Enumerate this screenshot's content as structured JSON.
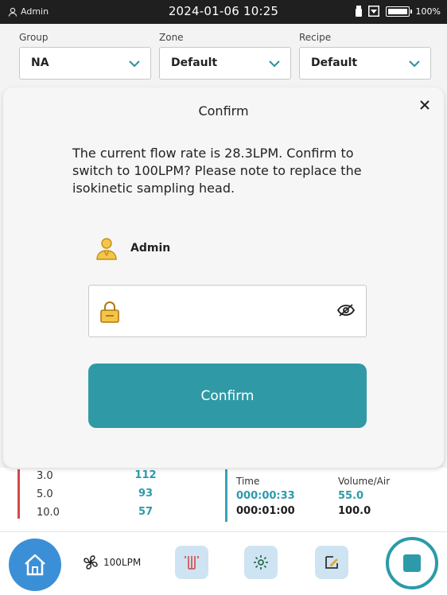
{
  "status_bar": {
    "user": "Admin",
    "datetime": "2024-01-06 10:25",
    "battery": "100%"
  },
  "filters": {
    "group": {
      "label": "Group",
      "value": "NA"
    },
    "zone": {
      "label": "Zone",
      "value": "Default"
    },
    "recipe": {
      "label": "Recipe",
      "value": "Default"
    }
  },
  "dialog": {
    "title": "Confirm",
    "message": "The current flow rate is 28.3LPM. Confirm to switch to 100LPM? Please note to replace the isokinetic sampling head.",
    "user": "Admin",
    "password_value": "",
    "confirm_label": "Confirm"
  },
  "particle_table": {
    "rows": [
      {
        "size": "3.0",
        "count": "112"
      },
      {
        "size": "5.0",
        "count": "93"
      },
      {
        "size": "10.0",
        "count": "57"
      }
    ]
  },
  "sample_info": {
    "time_label": "Time",
    "volume_label": "Volume/Air",
    "elapsed": "000:00:33",
    "total_time": "000:01:00",
    "volume": "55.0",
    "total_volume": "100.0"
  },
  "bottom_nav": {
    "flow": "100LPM"
  },
  "colors": {
    "accent": "#2f9aa6",
    "home": "#3b8fd6",
    "status_bar": "#1f1f1f"
  }
}
